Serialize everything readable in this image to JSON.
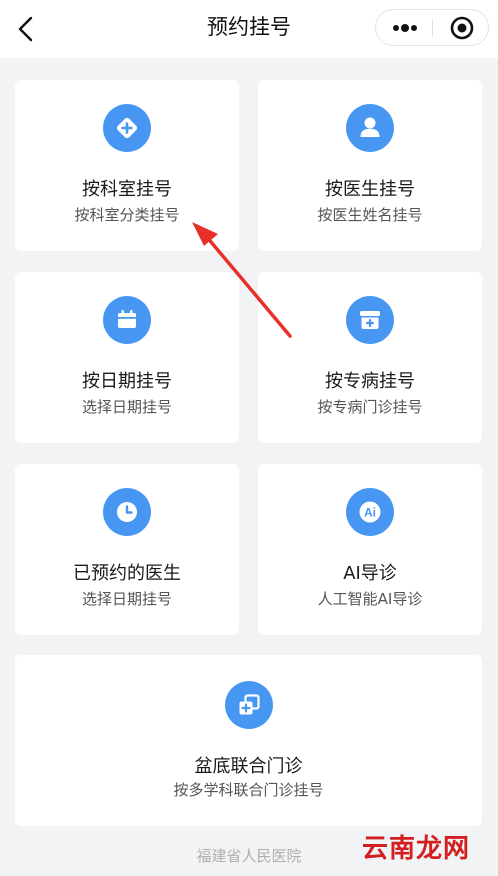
{
  "navbar": {
    "title": "预约挂号",
    "back_icon": "chevron-left-icon",
    "more_icon": "more-dots-icon",
    "close_icon": "target-circle-icon"
  },
  "cards": [
    {
      "title": "按科室挂号",
      "subtitle": "按科室分类挂号",
      "icon": "department-icon"
    },
    {
      "title": "按医生挂号",
      "subtitle": "按医生姓名挂号",
      "icon": "doctor-icon"
    },
    {
      "title": "按日期挂号",
      "subtitle": "选择日期挂号",
      "icon": "calendar-icon"
    },
    {
      "title": "按专病挂号",
      "subtitle": "按专病门诊挂号",
      "icon": "medical-box-icon"
    },
    {
      "title": "已预约的医生",
      "subtitle": "选择日期挂号",
      "icon": "clock-icon"
    },
    {
      "title": "AI导诊",
      "subtitle": "人工智能AI导诊",
      "icon": "ai-icon"
    },
    {
      "title": "盆底联合门诊",
      "subtitle": "按多学科联合门诊挂号",
      "icon": "joint-clinic-icon"
    }
  ],
  "footer": "福建省人民医院",
  "watermark": "云南龙网",
  "colors": {
    "accent": "#4797f2",
    "background": "#f2f3f5",
    "annotation_arrow": "#e8302a"
  }
}
